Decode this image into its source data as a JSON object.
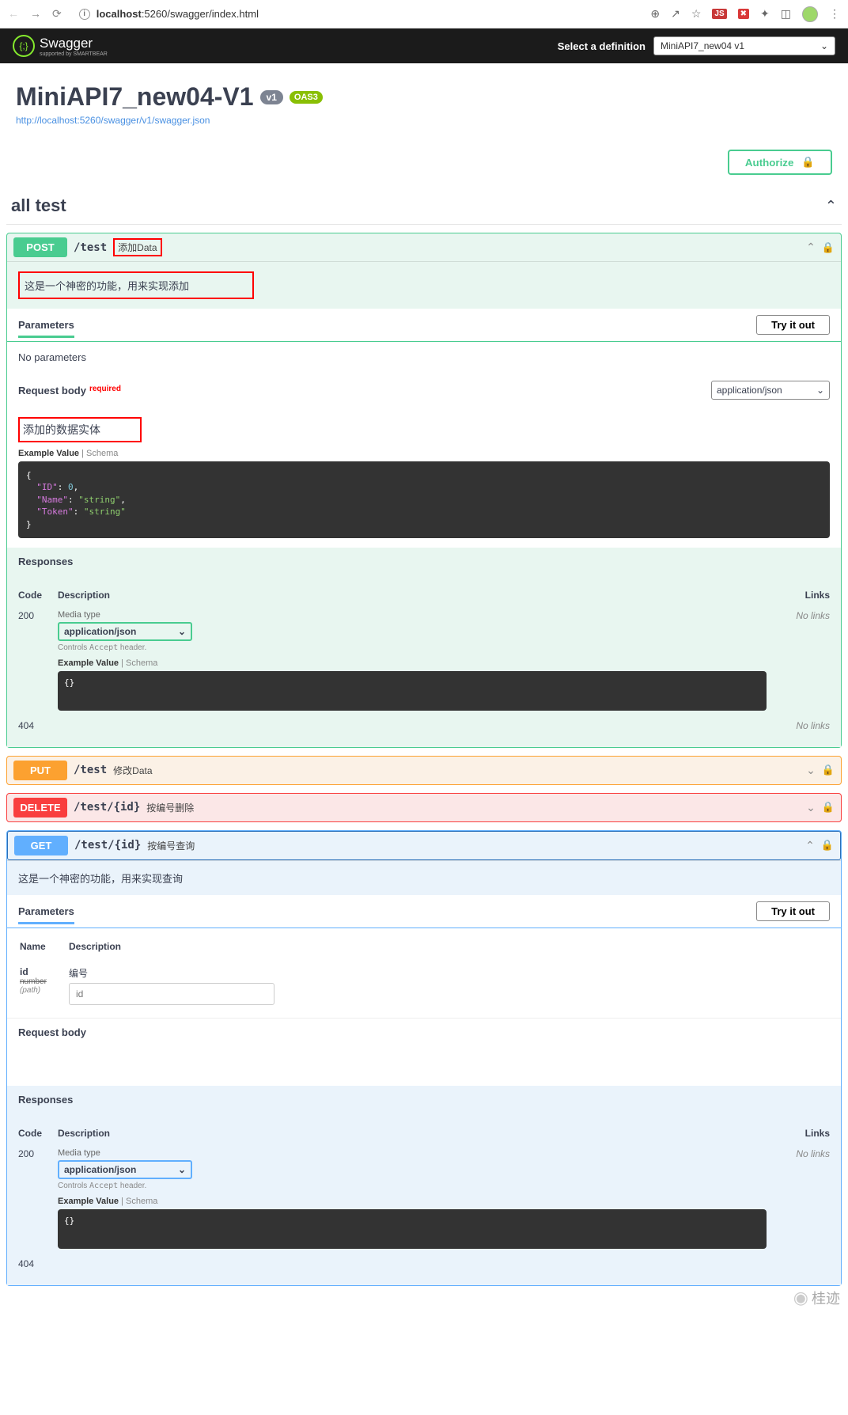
{
  "browser": {
    "url_prefix": "localhost",
    "url_rest": ":5260/swagger/index.html"
  },
  "topbar": {
    "logo_text": "Swagger",
    "logo_sub": "supported by SMARTBEAR",
    "def_label": "Select a definition",
    "def_value": "MiniAPI7_new04 v1"
  },
  "info": {
    "title": "MiniAPI7_new04-V1",
    "version": "v1",
    "oas": "OAS3",
    "url": "http://localhost:5260/swagger/v1/swagger.json"
  },
  "authorize": "Authorize",
  "tag": "all test",
  "ops": {
    "post": {
      "method": "POST",
      "path": "/test",
      "summary": "添加Data",
      "description": "这是一个神密的功能，用来实现添加",
      "params_title": "Parameters",
      "try": "Try it out",
      "no_params": "No parameters",
      "reqbody_title": "Request body",
      "required": "required",
      "content_type": "application/json",
      "reqbody_desc": "添加的数据实体",
      "tab_example": "Example Value",
      "tab_schema": "Schema",
      "example": "{\n  \"ID\": 0,\n  \"Name\": \"string\",\n  \"Token\": \"string\"\n}",
      "responses_title": "Responses",
      "col_code": "Code",
      "col_desc": "Description",
      "col_links": "Links",
      "media_label": "Media type",
      "controls_text": "Controls Accept header.",
      "resp_example": "{}",
      "no_links": "No links",
      "code200": "200",
      "code404": "404"
    },
    "put": {
      "method": "PUT",
      "path": "/test",
      "summary": "修改Data"
    },
    "delete": {
      "method": "DELETE",
      "path": "/test/{id}",
      "summary": "按编号删除"
    },
    "get": {
      "method": "GET",
      "path": "/test/{id}",
      "summary": "按编号查询",
      "description": "这是一个神密的功能，用来实现查询",
      "params_title": "Parameters",
      "try": "Try it out",
      "th_name": "Name",
      "th_desc": "Description",
      "param_name": "id",
      "param_type": "number",
      "param_in": "(path)",
      "param_desc": "编号",
      "param_placeholder": "id",
      "reqbody_title": "Request body",
      "responses_title": "Responses",
      "col_code": "Code",
      "col_desc": "Description",
      "col_links": "Links",
      "media_label": "Media type",
      "content_type": "application/json",
      "controls_text": "Controls Accept header.",
      "tab_example": "Example Value",
      "tab_schema": "Schema",
      "resp_example": "{}",
      "no_links": "No links",
      "code200": "200",
      "code404": "404"
    }
  },
  "watermark": "桂迹"
}
